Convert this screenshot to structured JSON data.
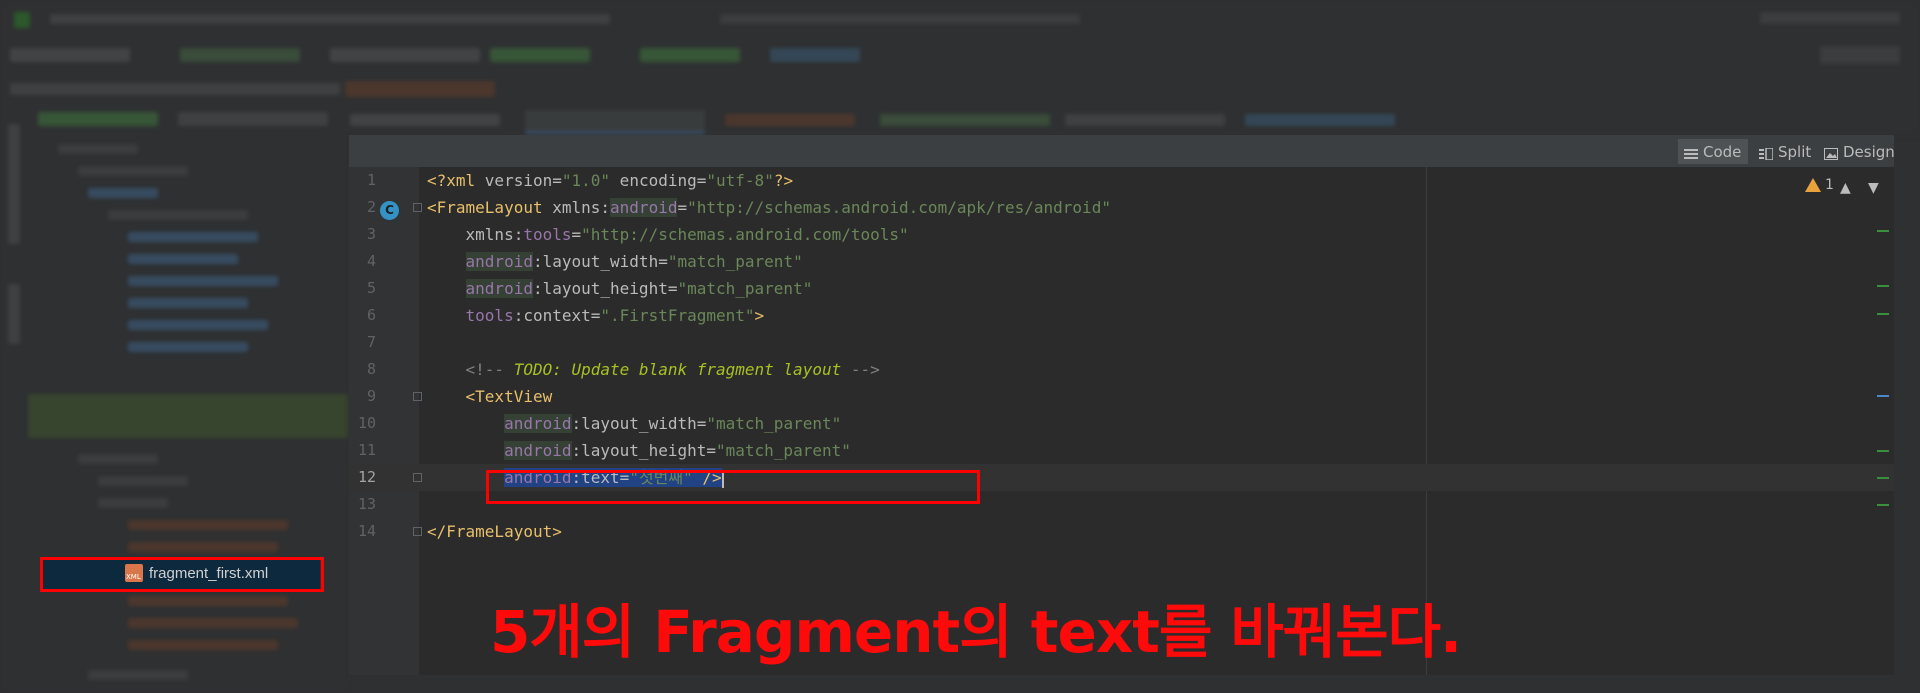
{
  "editor": {
    "view_modes": [
      {
        "label": "Code",
        "active": true
      },
      {
        "label": "Split",
        "active": false
      },
      {
        "label": "Design",
        "active": false
      }
    ],
    "warnings_count": "1",
    "gutter_badge": "C",
    "lines": [
      {
        "n": "1"
      },
      {
        "n": "2"
      },
      {
        "n": "3"
      },
      {
        "n": "4"
      },
      {
        "n": "5"
      },
      {
        "n": "6"
      },
      {
        "n": "7"
      },
      {
        "n": "8"
      },
      {
        "n": "9"
      },
      {
        "n": "10"
      },
      {
        "n": "11"
      },
      {
        "n": "12"
      },
      {
        "n": "13"
      },
      {
        "n": "14"
      }
    ],
    "code": {
      "l1": {
        "a": "<?xml ",
        "b": "version",
        "c": "=",
        "d": "\"1.0\"",
        "e": " encoding",
        "f": "=",
        "g": "\"utf-8\"",
        "h": "?>"
      },
      "l2": {
        "a": "<FrameLayout ",
        "b": "xmlns:",
        "c": "android",
        "d": "=",
        "e": "\"http://schemas.android.com/apk/res/android\""
      },
      "l3": {
        "a": "    xmlns:",
        "b": "tools",
        "c": "=",
        "d": "\"http://schemas.android.com/tools\""
      },
      "l4": {
        "a": "    ",
        "b": "android",
        "c": ":layout_width",
        "d": "=",
        "e": "\"match_parent\""
      },
      "l5": {
        "a": "    ",
        "b": "android",
        "c": ":layout_height",
        "d": "=",
        "e": "\"match_parent\""
      },
      "l6": {
        "a": "    ",
        "b": "tools",
        "c": ":context",
        "d": "=",
        "e": "\".FirstFragment\"",
        "f": ">"
      },
      "l8": {
        "a": "    <!-- ",
        "b": "TODO: Update blank fragment layout",
        "c": " -->"
      },
      "l9": {
        "a": "    ",
        "b": "<TextView"
      },
      "l10": {
        "a": "        ",
        "b": "android",
        "c": ":layout_width",
        "d": "=",
        "e": "\"match_parent\""
      },
      "l11": {
        "a": "        ",
        "b": "android",
        "c": ":layout_height",
        "d": "=",
        "e": "\"match_parent\""
      },
      "l12": {
        "a": "        ",
        "b": "android",
        "c": ":text",
        "d": "=",
        "e": "\"첫번째\"",
        "f": " />"
      },
      "l14": {
        "a": "</FrameLayout>"
      }
    }
  },
  "project_tree": {
    "selected_file": "fragment_first.xml",
    "file_icon_text": "XML"
  },
  "annotation": {
    "caption": "5개의 Fragment의 text를 바꿔본다."
  },
  "colors": {
    "highlight_box": "#ff0000",
    "caption": "#ff0a0a"
  }
}
